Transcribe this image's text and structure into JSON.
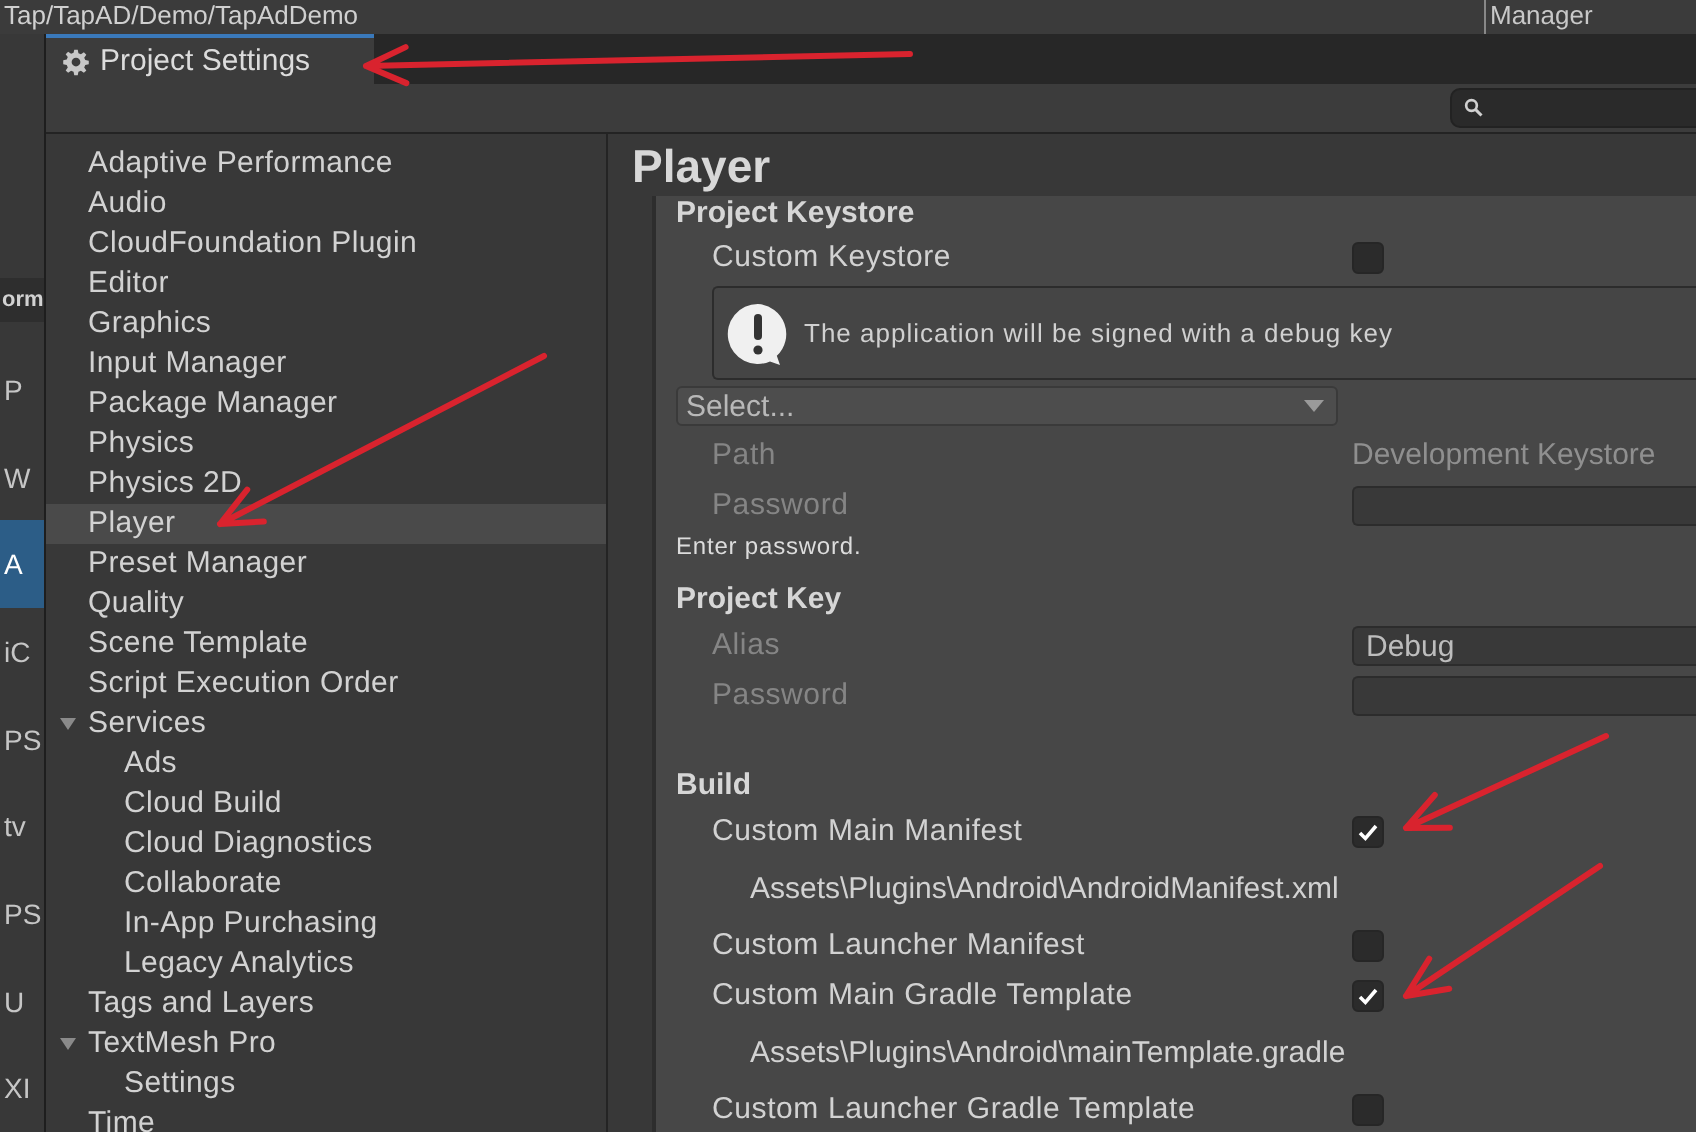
{
  "editor_background": {
    "breadcrumb": "Tap/TapAD/Demo/TapAdDemo",
    "corner_label": "Manager",
    "list_header": "orm",
    "list_items": [
      {
        "label": "P",
        "selected": false
      },
      {
        "label": "W",
        "selected": false
      },
      {
        "label": "A",
        "selected": true
      },
      {
        "label": "iC",
        "selected": false
      },
      {
        "label": "PS",
        "selected": false
      },
      {
        "label": "tv",
        "selected": false
      },
      {
        "label": "PS",
        "selected": false
      },
      {
        "label": "U",
        "selected": false
      },
      {
        "label": "XI",
        "selected": false
      }
    ]
  },
  "window": {
    "title": "Project Settings"
  },
  "sidebar": {
    "items": [
      {
        "label": "Adaptive Performance",
        "selected": false
      },
      {
        "label": "Audio",
        "selected": false
      },
      {
        "label": "CloudFoundation Plugin",
        "selected": false
      },
      {
        "label": "Editor",
        "selected": false
      },
      {
        "label": "Graphics",
        "selected": false
      },
      {
        "label": "Input Manager",
        "selected": false
      },
      {
        "label": "Package Manager",
        "selected": false
      },
      {
        "label": "Physics",
        "selected": false
      },
      {
        "label": "Physics 2D",
        "selected": false
      },
      {
        "label": "Player",
        "selected": true
      },
      {
        "label": "Preset Manager",
        "selected": false
      },
      {
        "label": "Quality",
        "selected": false
      },
      {
        "label": "Scene Template",
        "selected": false
      },
      {
        "label": "Script Execution Order",
        "selected": false
      },
      {
        "label": "Services",
        "selected": false,
        "expanded": true,
        "children": [
          {
            "label": "Ads",
            "selected": false
          },
          {
            "label": "Cloud Build",
            "selected": false
          },
          {
            "label": "Cloud Diagnostics",
            "selected": false
          },
          {
            "label": "Collaborate",
            "selected": false
          },
          {
            "label": "In-App Purchasing",
            "selected": false
          },
          {
            "label": "Legacy Analytics",
            "selected": false
          }
        ]
      },
      {
        "label": "Tags and Layers",
        "selected": false
      },
      {
        "label": "TextMesh Pro",
        "selected": false,
        "expanded": true,
        "children": [
          {
            "label": "Settings",
            "selected": false
          }
        ]
      },
      {
        "label": "Time",
        "selected": false
      }
    ]
  },
  "panel": {
    "title": "Player",
    "groups": [
      {
        "title": "Project Keystore",
        "rows": [
          {
            "kind": "checkbox",
            "label": "Custom Keystore",
            "checked": false
          },
          {
            "kind": "info",
            "text": "The application will be signed with a debug key"
          },
          {
            "kind": "dropdown",
            "value": "Select..."
          },
          {
            "kind": "value",
            "label": "Path",
            "value": "Development Keystore",
            "disabled": true
          },
          {
            "kind": "field",
            "label": "Password",
            "disabled": true
          },
          {
            "kind": "hint",
            "text": "Enter password."
          }
        ]
      },
      {
        "title": "Project Key",
        "rows": [
          {
            "kind": "field",
            "label": "Alias",
            "value": "Debug",
            "disabled": true
          },
          {
            "kind": "field",
            "label": "Password",
            "disabled": true
          }
        ]
      },
      {
        "title": "Build",
        "rows": [
          {
            "kind": "checkbox",
            "label": "Custom Main Manifest",
            "checked": true
          },
          {
            "kind": "path",
            "text": "Assets\\Plugins\\Android\\AndroidManifest.xml"
          },
          {
            "kind": "checkbox",
            "label": "Custom Launcher Manifest",
            "checked": false
          },
          {
            "kind": "checkbox",
            "label": "Custom Main Gradle Template",
            "checked": true
          },
          {
            "kind": "path",
            "text": "Assets\\Plugins\\Android\\mainTemplate.gradle"
          },
          {
            "kind": "checkbox",
            "label": "Custom Launcher Gradle Template",
            "checked": false
          }
        ]
      }
    ]
  }
}
